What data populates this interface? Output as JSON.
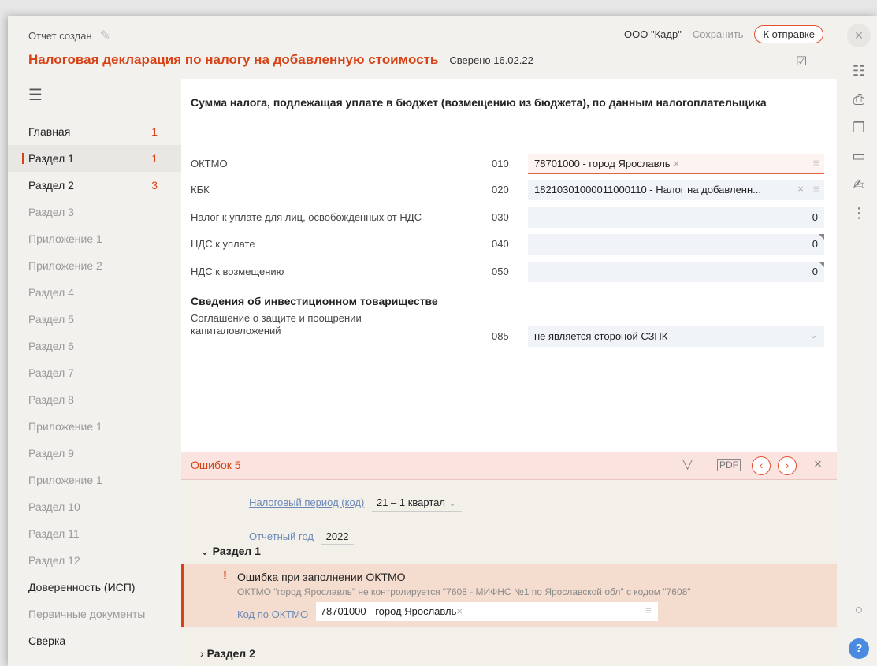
{
  "header": {
    "created": "Отчет создан",
    "org": "ООО \"Кадр\"",
    "save_label": "Сохранить",
    "send_label": "К отправке",
    "title": "Налоговая декларация по налогу на добавленную стоимость",
    "checked": "Сверено 16.02.22"
  },
  "sidebar": {
    "items": [
      {
        "label": "Главная",
        "count": "1"
      },
      {
        "label": "Раздел 1",
        "count": "1"
      },
      {
        "label": "Раздел 2",
        "count": "3"
      },
      {
        "label": "Раздел 3",
        "count": ""
      },
      {
        "label": "Приложение 1",
        "count": ""
      },
      {
        "label": "Приложение 2",
        "count": ""
      },
      {
        "label": "Раздел 4",
        "count": ""
      },
      {
        "label": "Раздел 5",
        "count": ""
      },
      {
        "label": "Раздел 6",
        "count": ""
      },
      {
        "label": "Раздел 7",
        "count": ""
      },
      {
        "label": "Раздел 8",
        "count": ""
      },
      {
        "label": "Приложение 1",
        "count": ""
      },
      {
        "label": "Раздел 9",
        "count": ""
      },
      {
        "label": "Приложение 1",
        "count": ""
      },
      {
        "label": "Раздел 10",
        "count": ""
      },
      {
        "label": "Раздел 11",
        "count": ""
      },
      {
        "label": "Раздел 12",
        "count": ""
      },
      {
        "label": "Доверенность (ИСП)",
        "count": ""
      },
      {
        "label": "Первичные документы",
        "count": ""
      },
      {
        "label": "Сверка",
        "count": ""
      }
    ]
  },
  "main": {
    "section_title": "Сумма налога, подлежащая уплате в бюджет (возмещению из бюджета), по данным налогоплательщика",
    "fields": [
      {
        "label": "ОКТМО",
        "code": "010",
        "value": "78701000 - город Ярославль"
      },
      {
        "label": "КБК",
        "code": "020",
        "value": "18210301000011000110 - Налог на добавленн..."
      },
      {
        "label": "Налог к уплате для лиц, освобожденных от НДС",
        "code": "030",
        "value": "0"
      },
      {
        "label": "НДС к уплате",
        "code": "040",
        "value": "0"
      },
      {
        "label": "НДС к возмещению",
        "code": "050",
        "value": "0"
      }
    ],
    "invest_title": "Сведения об инвестиционном товариществе",
    "invest_label": "Соглашение о защите и поощрении капиталовложений",
    "invest_code": "085",
    "invest_value": "не является стороной СЗПК"
  },
  "errors": {
    "title": "Ошибок 5",
    "period_label": "Налоговый период (код)",
    "period_value": "21 – 1 квартал",
    "year_label": "Отчетный год",
    "year_value": "2022",
    "section1": "Раздел 1",
    "section2": "Раздел 2",
    "item_title": "Ошибка при заполнении ОКТМО",
    "item_desc": "ОКТМО \"город Ярославль\" не контролируется \"7608 - МИФНС №1 по Ярославской обл\" с кодом \"7608\"",
    "item_field_label": "Код по ОКТМО",
    "item_field_value": "78701000 - город Ярославль"
  },
  "colors": {
    "accent": "#d64316",
    "link": "#6b8ab8",
    "help": "#4a8be0"
  }
}
